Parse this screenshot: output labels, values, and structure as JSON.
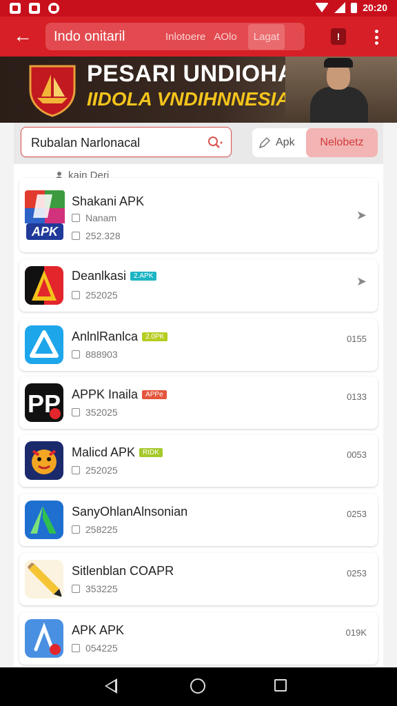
{
  "status_bar": {
    "time": "20:20"
  },
  "app_bar": {
    "title": "Indo onitaril",
    "tabs": [
      "Inlotoere",
      "AOlo",
      "Lagat"
    ],
    "active_tab": "Lagat"
  },
  "banner": {
    "line1": "PESARI UNDIOHAN",
    "line2": "IIDOLA VNDIHNNESIA"
  },
  "search": {
    "text": "Rubalan Narlonacal",
    "apk_button": "Apk",
    "network_button": "Nelobetz"
  },
  "section_label": "kain Deri",
  "colors": {
    "brand_red": "#d61f26",
    "status_red": "#c8101c"
  },
  "apps": [
    {
      "name": "Shakani APK",
      "sub1": "Nanam",
      "sub2": "252.328",
      "badge": "",
      "badge_color": "",
      "right": "",
      "icon": "apk-multicolor-icon"
    },
    {
      "name": "Deanlkasi",
      "sub1": "252025",
      "sub2": "",
      "badge": "2.APK",
      "badge_color": "#1db5c4",
      "right": "",
      "icon": "triangle-a-icon"
    },
    {
      "name": "AnlnlRanlca",
      "sub1": "888903",
      "sub2": "",
      "badge": "2.0PK",
      "badge_color": "#b6cc21",
      "right": "0155",
      "icon": "blue-a-icon"
    },
    {
      "name": "APPK Inaila",
      "sub1": "352025",
      "sub2": "",
      "badge": "APPe",
      "badge_color": "#e4553c",
      "right": "0133",
      "icon": "pp-icon"
    },
    {
      "name": "Malicd APK",
      "sub1": "252025",
      "sub2": "",
      "badge": "RIDK",
      "badge_color": "#a5c92a",
      "right": "0053",
      "icon": "tiger-mascot-icon"
    },
    {
      "name": "SanyOhlanAlnsonian",
      "sub1": "258225",
      "sub2": "",
      "badge": "",
      "badge_color": "",
      "right": "0253",
      "icon": "green-a-icon"
    },
    {
      "name": "Sitlenblan COAPR",
      "sub1": "353225",
      "sub2": "",
      "badge": "",
      "badge_color": "",
      "right": "0253",
      "icon": "pencil-icon"
    },
    {
      "name": "APK APK",
      "sub1": "054225",
      "sub2": "",
      "badge": "",
      "badge_color": "",
      "right": "019K",
      "icon": "a-link-icon"
    }
  ]
}
